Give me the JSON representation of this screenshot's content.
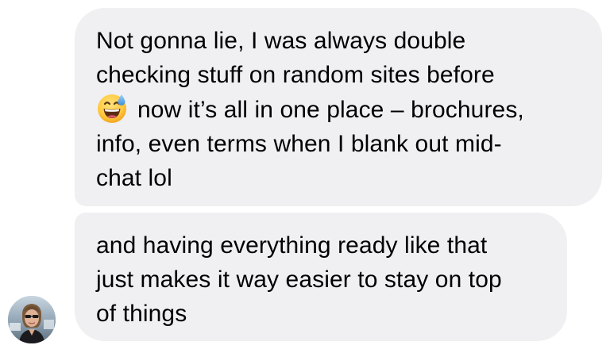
{
  "messages": [
    {
      "sender": "other",
      "lines": [
        "Not gonna lie, I was always double",
        "checking stuff on random sites before",
        "now it’s all in one place – brochures,",
        "info, even terms when I blank out mid-",
        "chat lol"
      ],
      "emoji": "grinning-face-with-sweat-icon"
    },
    {
      "sender": "other",
      "lines": [
        "and having everything ready like that",
        "just makes it way easier to stay on top",
        "of things"
      ]
    }
  ],
  "colors": {
    "bubble_background": "#f0f0f2",
    "text": "#000000",
    "emoji_face": "#ffc83d",
    "emoji_sweat": "#5aa9e6"
  },
  "avatar": {
    "icon": "avatar-photo-woman-sunglasses"
  }
}
